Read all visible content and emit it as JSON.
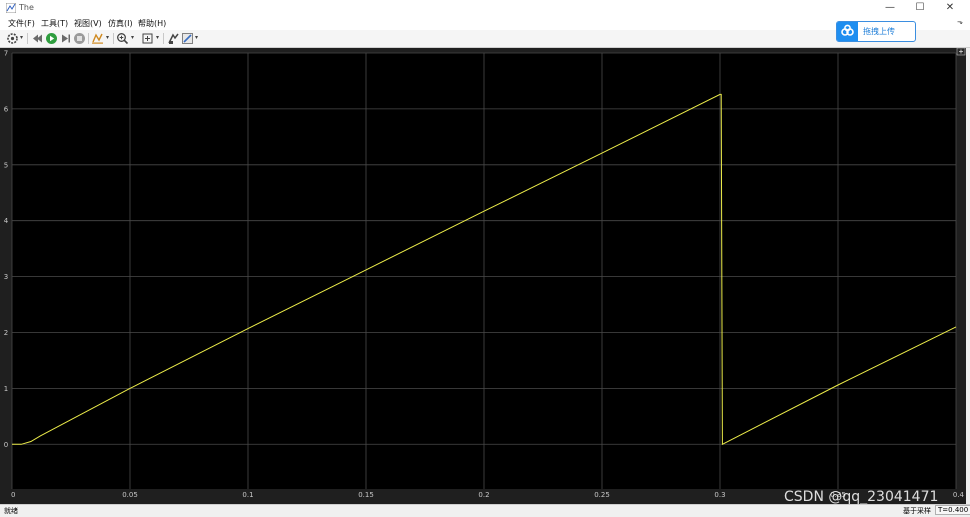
{
  "window": {
    "title": "The",
    "minimize_glyph": "—",
    "maximize_glyph": "☐",
    "close_glyph": "✕"
  },
  "menu": {
    "items": [
      "文件(F)",
      "工具(T)",
      "视图(V)",
      "仿真(I)",
      "帮助(H)"
    ]
  },
  "toolbar": {
    "icons": [
      "settings-icon",
      "back-icon",
      "run-icon",
      "step-forward-icon",
      "stop-icon",
      "highlight-icon",
      "zoom-icon",
      "fit-icon",
      "layout-icon",
      "style-icon"
    ]
  },
  "upload": {
    "label": "拖拽上传",
    "icon": "baidu-cloud-icon",
    "accent": "#1e8ef0"
  },
  "status": {
    "text": "就绪",
    "mode": "基于采样",
    "time": "T=0.400"
  },
  "watermark": "CSDN @qq_23041471",
  "colors": {
    "scope_background": "#1f1f1f",
    "plot_background": "#000000",
    "grid": "#4a4a4a",
    "trace": "#ecec4a"
  },
  "chart_data": {
    "type": "line",
    "title": "",
    "xlabel": "",
    "ylabel": "",
    "xlim": [
      0,
      0.4
    ],
    "ylim": [
      -0.8,
      7
    ],
    "xticks": [
      "0",
      "0.05",
      "0.1",
      "0.15",
      "0.2",
      "0.25",
      "0.3",
      "0.35",
      "0.4"
    ],
    "yticks": [
      "0",
      "1",
      "2",
      "3",
      "4",
      "5",
      "6",
      "7"
    ],
    "grid": true,
    "series": [
      {
        "x": [
          0,
          0.004,
          0.008,
          0.012,
          0.05,
          0.1,
          0.15,
          0.2,
          0.25,
          0.3,
          0.3005,
          0.301,
          0.35,
          0.4
        ],
        "y": [
          0,
          0,
          0.05,
          0.15,
          1.0,
          2.07,
          3.12,
          4.17,
          5.21,
          6.26,
          6.26,
          0.0,
          1.06,
          2.1
        ]
      }
    ]
  }
}
